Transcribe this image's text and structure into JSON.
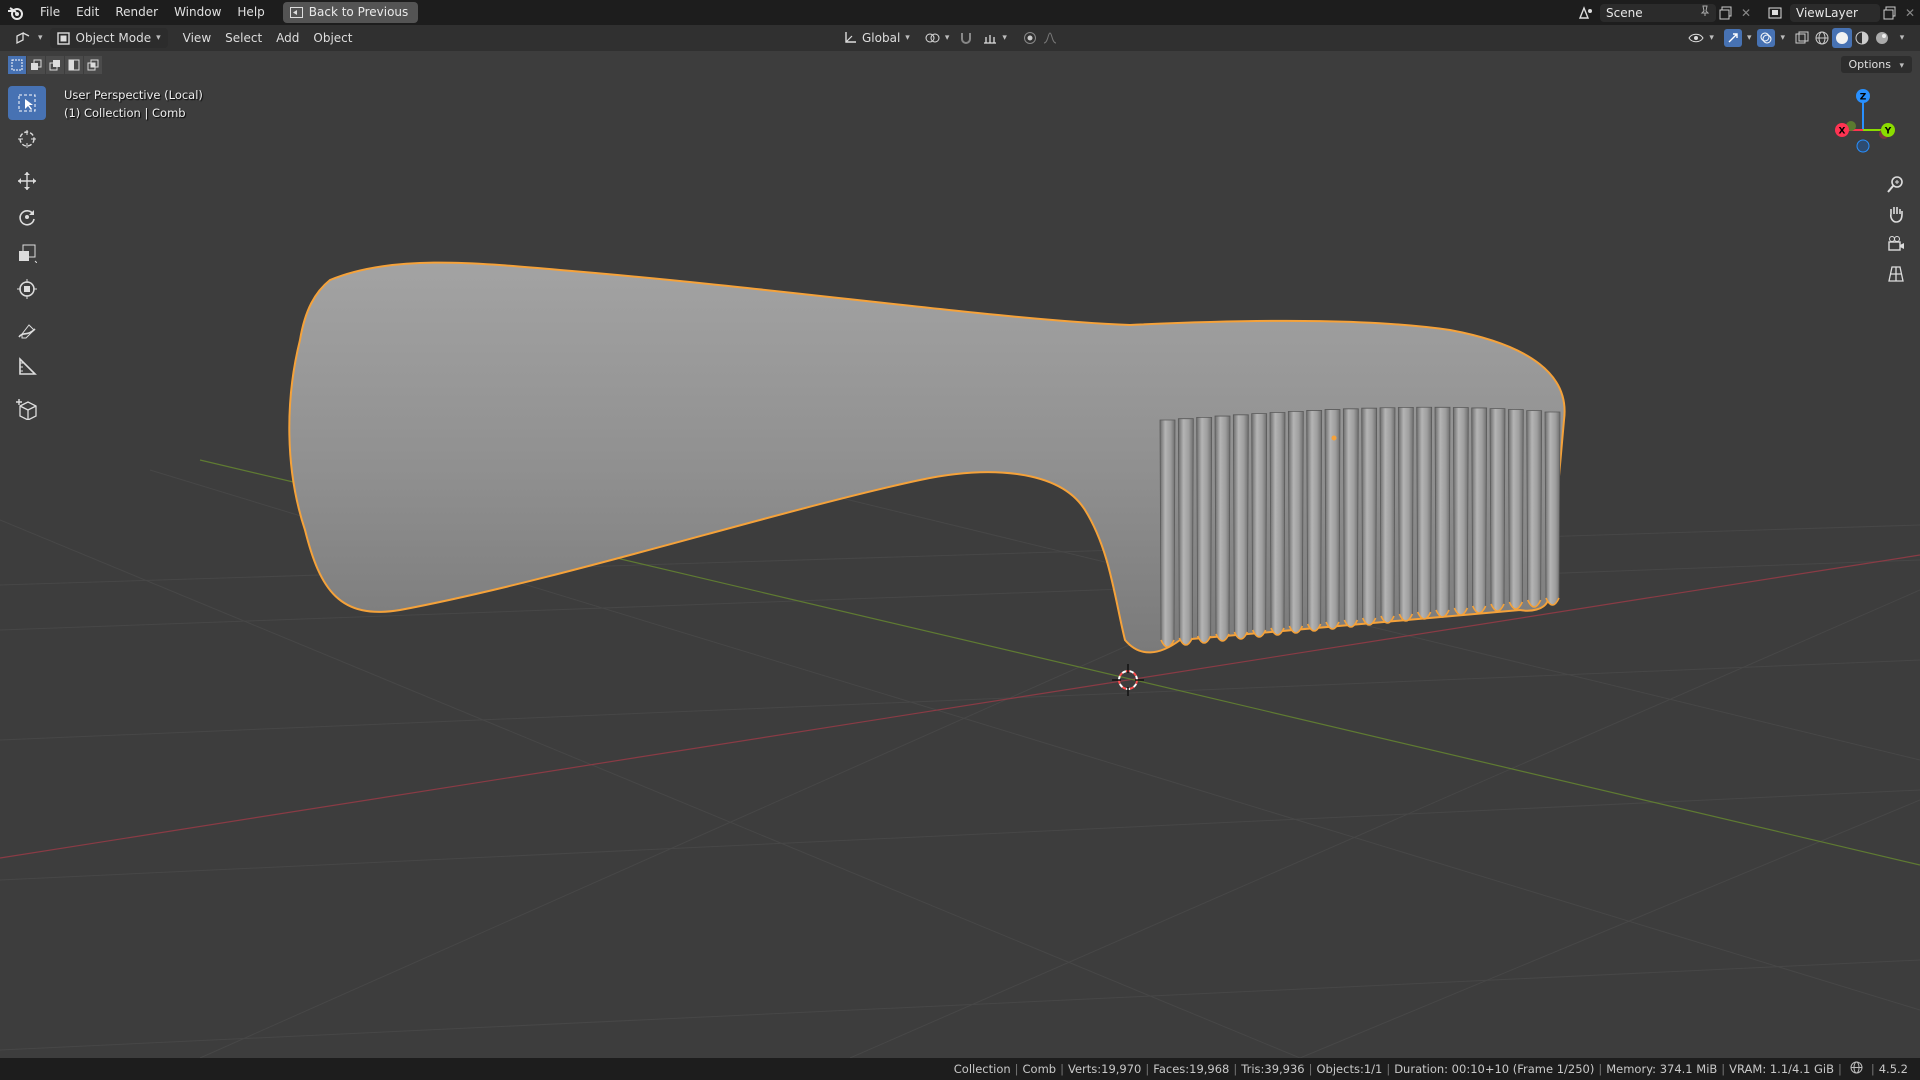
{
  "menu": [
    "File",
    "Edit",
    "Render",
    "Window",
    "Help"
  ],
  "back_button": "Back to Previous",
  "scene": {
    "name": "Scene",
    "view_layer": "ViewLayer"
  },
  "header": {
    "mode": "Object Mode",
    "menus": [
      "View",
      "Select",
      "Add",
      "Object"
    ],
    "orientation": "Global",
    "options": "Options"
  },
  "viewport": {
    "perspective": "User Perspective (Local)",
    "collection_info": "(1) Collection | Comb"
  },
  "gizmo": {
    "x": "X",
    "y": "Y",
    "z": "Z"
  },
  "tools": [
    "select-box",
    "cursor",
    "move",
    "rotate",
    "scale",
    "transform",
    "annotate",
    "measure",
    "add-cube"
  ],
  "statusbar": {
    "collection": "Collection",
    "object": "Comb",
    "verts": "Verts:19,970",
    "faces": "Faces:19,968",
    "tris": "Tris:39,936",
    "objects": "Objects:1/1",
    "duration": "Duration: 00:10+10 (Frame 1/250)",
    "memory": "Memory: 374.1 MiB",
    "vram": "VRAM: 1.1/4.1 GiB",
    "version": "4.5.2"
  },
  "colors": {
    "accent": "#4772b3",
    "selection_outline": "#f5a23a",
    "axis_x": "#ff3352",
    "axis_y": "#8bdc00",
    "axis_z": "#2890ff",
    "viewport_bg": "#3d3d3d"
  }
}
